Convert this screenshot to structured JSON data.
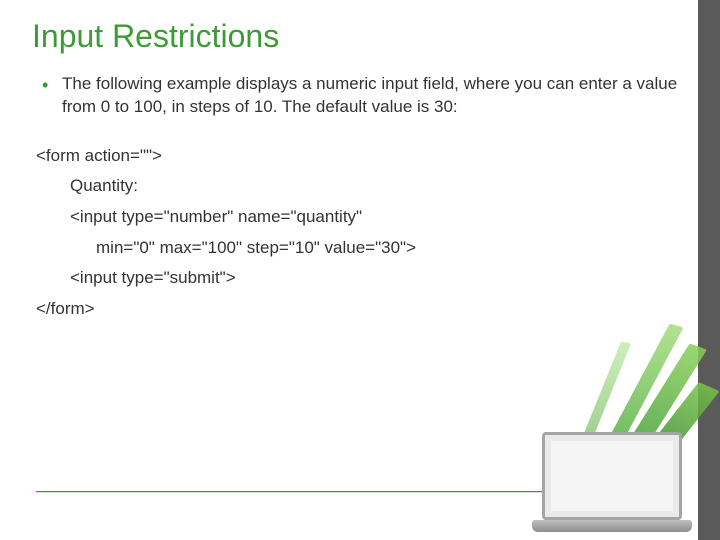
{
  "title": "Input Restrictions",
  "bullet": "The following example displays a numeric input field, where you can enter a value from 0 to 100, in steps of 10. The default value is 30:",
  "code": {
    "l1": "<form action=\"\">",
    "l2": "Quantity:",
    "l3": "<input type=\"number\" name=\"quantity\"",
    "l4": "min=\"0\" max=\"100\" step=\"10\" value=\"30\">",
    "l5": "<input type=\"submit\">",
    "l6": "</form>"
  }
}
